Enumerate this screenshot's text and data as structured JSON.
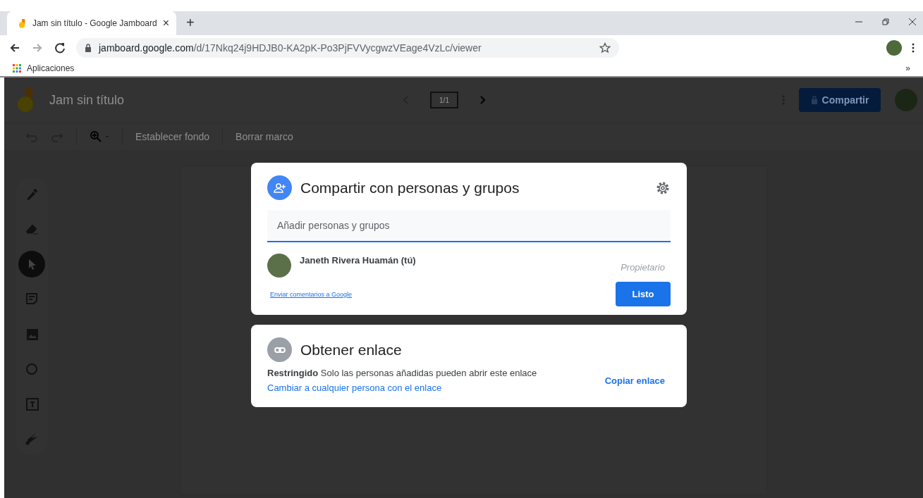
{
  "browser": {
    "tab": {
      "title": "Jam sin título - Google Jamboard",
      "close": "×"
    },
    "new_tab": "+",
    "url": {
      "host": "jamboard.google.com",
      "path": "/d/17Nkq24j9HDJB0-KA2pK-Po3PjFVVycgwzVEage4VzLc/viewer"
    },
    "bookmarks": [
      {
        "label": "Aplicaciones"
      }
    ],
    "overflow": "»"
  },
  "app": {
    "title": "Jam sin título",
    "frame_counter": "1/1",
    "share_button": "Compartir",
    "toolbar": [
      {
        "kind": "undo"
      },
      {
        "kind": "redo"
      },
      {
        "kind": "zoom"
      },
      {
        "kind": "text",
        "label": "Establecer fondo"
      },
      {
        "kind": "text",
        "label": "Borrar marco"
      }
    ],
    "tools": [
      {
        "kind": "pen",
        "selected": false
      },
      {
        "kind": "eraser",
        "selected": false
      },
      {
        "kind": "select",
        "selected": true
      },
      {
        "kind": "note",
        "selected": false
      },
      {
        "kind": "image",
        "selected": false
      },
      {
        "kind": "circle",
        "selected": false
      },
      {
        "kind": "textbox",
        "selected": false
      },
      {
        "kind": "laser",
        "selected": false
      }
    ]
  },
  "share_dialog": {
    "title": "Compartir con personas y grupos",
    "input": {
      "placeholder": "Añadir personas y grupos"
    },
    "people": [
      {
        "name": "Janeth Rivera Huamán (tú)",
        "role": "Propietario"
      }
    ],
    "feedback_link": "Enviar comentarios a Google",
    "done_button": "Listo"
  },
  "link_dialog": {
    "title": "Obtener enlace",
    "access": "**Restringido** Solo las personas añadidas pueden abrir este enlace",
    "change_link": "Cambiar a cualquier persona con el enlace",
    "copy_button": "Copiar enlace"
  }
}
